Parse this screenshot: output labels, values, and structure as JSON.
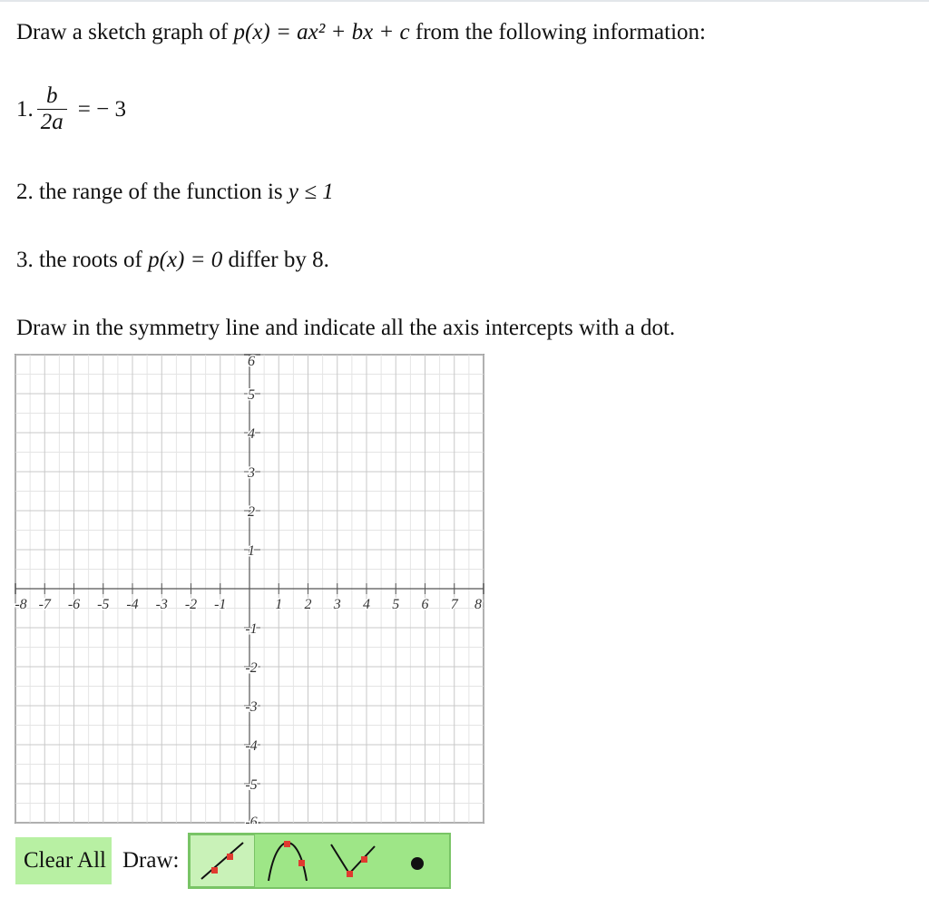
{
  "question": {
    "intro_pre": "Draw a sketch graph of ",
    "intro_fn": "p(x) = ax² + bx + c",
    "intro_post": " from the following information:",
    "item1_num": "1.",
    "item1_frac_num": "b",
    "item1_frac_den": "2a",
    "item1_rhs": "= − 3",
    "item2_pre": "2. the range of the function is ",
    "item2_math": "y ≤ 1",
    "item3_pre": "3. the roots of ",
    "item3_math": "p(x) = 0",
    "item3_post": " differ by 8.",
    "instruction": "Draw in the symmetry line and indicate all the axis intercepts with a dot."
  },
  "graph": {
    "x_range": [
      -8,
      8
    ],
    "y_range": [
      -6,
      6
    ],
    "x_tick_labels": [
      "-8",
      "-7",
      "-6",
      "-5",
      "-4",
      "-3",
      "-2",
      "-1",
      "1",
      "2",
      "3",
      "4",
      "5",
      "6",
      "7",
      "8"
    ],
    "y_tick_labels": [
      "6",
      "5",
      "4",
      "3",
      "2",
      "1",
      "-1",
      "-2",
      "-3",
      "-4",
      "-5",
      "-6"
    ],
    "grid_color": "#c8c8c8",
    "axis_color": "#555555"
  },
  "toolbar": {
    "clear_label": "Clear All",
    "draw_label": "Draw:",
    "tools": [
      "line-tool-icon",
      "parabola-down-icon",
      "vee-tool-icon",
      "point-tool-icon"
    ],
    "accent": "#b8f0a3",
    "marker_color": "#e03a2f"
  }
}
